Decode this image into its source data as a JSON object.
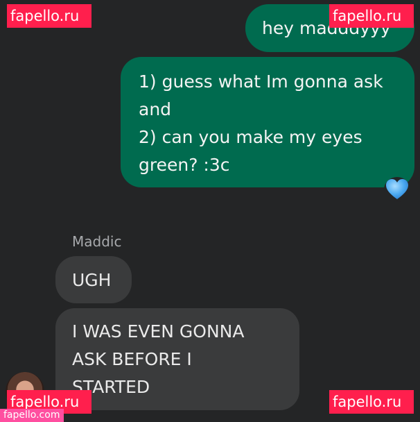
{
  "messages": {
    "outgoing": [
      {
        "text": "hey madddyyy"
      },
      {
        "text": "1) guess what Im gonna ask\nand\n2) can you make my eyes\ngreen? :3c"
      }
    ],
    "reaction": {
      "icon": "blue-heart-icon",
      "color": "#4aa8f0"
    },
    "sender_name": "Maddic",
    "incoming": [
      {
        "text": "UGH"
      },
      {
        "text": "I WAS EVEN GONNA\nASK BEFORE I\nSTARTED"
      }
    ]
  },
  "watermarks": {
    "top_left": "fapello.ru",
    "top_right": "fapello.ru",
    "bottom_left": "fapello.ru",
    "bottom_right": "fapello.ru",
    "bottom_small": "fapello.com"
  },
  "colors": {
    "background": "#242526",
    "outgoing_bubble": "#006b4f",
    "incoming_bubble": "#3a3b3c",
    "watermark": "#ff1f4d"
  }
}
